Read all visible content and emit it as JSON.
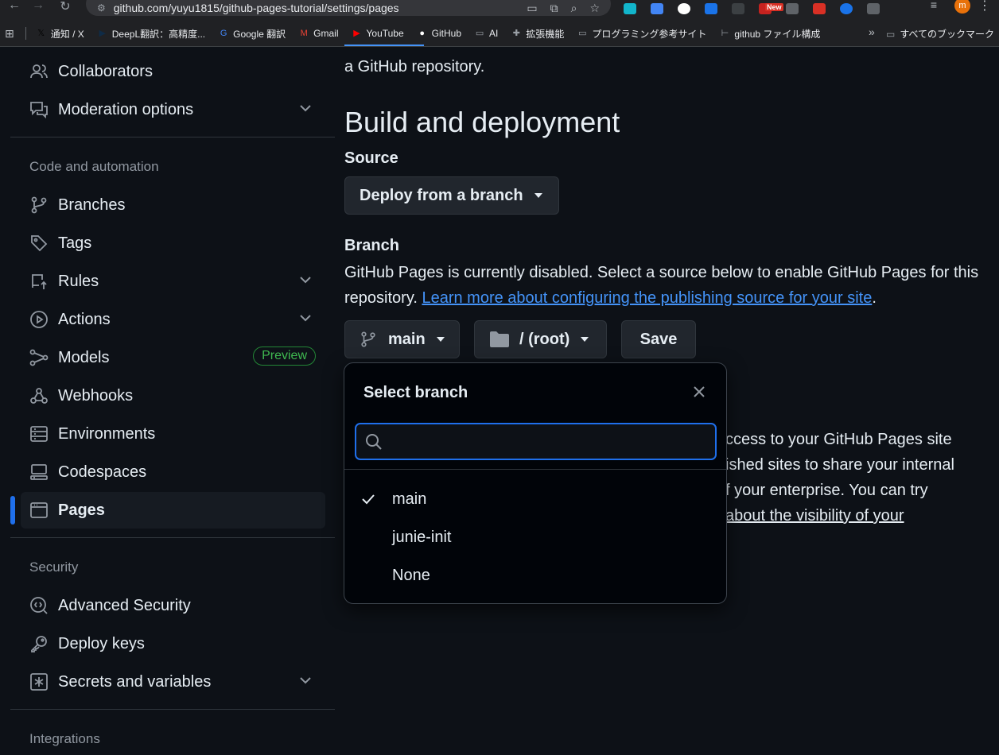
{
  "browser": {
    "url": "github.com/yuyu1815/github-pages-tutorial/settings/pages",
    "ext_new_badge": "New",
    "avatar_letter": "m",
    "bookmarks": [
      {
        "label": "通知 / X",
        "icon": "x-logo-icon",
        "color": "#000000"
      },
      {
        "label": "DeepL翻訳：高精度...",
        "icon": "deepl-icon",
        "color": "#0f2b46"
      },
      {
        "label": "Google 翻訳",
        "icon": "google-translate-icon",
        "color": "#4285f4"
      },
      {
        "label": "Gmail",
        "icon": "gmail-icon",
        "color": "#ea4335"
      },
      {
        "label": "YouTube",
        "icon": "youtube-icon",
        "color": "#ff0000"
      },
      {
        "label": "GitHub",
        "icon": "github-icon",
        "color": "#ffffff"
      },
      {
        "label": "AI",
        "icon": "folder-icon",
        "color": "#9aa0a6"
      },
      {
        "label": "拡張機能",
        "icon": "puzzle-icon",
        "color": "#9aa0a6"
      },
      {
        "label": "プログラミング参考サイト",
        "icon": "folder-icon",
        "color": "#9aa0a6"
      },
      {
        "label": "github ファイル構成",
        "icon": "doc-icon",
        "color": "#9aa0a6"
      }
    ],
    "all_bookmarks": "すべてのブックマーク"
  },
  "sidebar": {
    "top_items": [
      {
        "label": "Collaborators",
        "icon": "people-icon"
      },
      {
        "label": "Moderation options",
        "icon": "comment-discussion-icon",
        "expandable": true
      }
    ],
    "code_heading": "Code and automation",
    "code_items": [
      {
        "label": "Branches",
        "icon": "git-branch-icon"
      },
      {
        "label": "Tags",
        "icon": "tag-icon"
      },
      {
        "label": "Rules",
        "icon": "repo-push-icon",
        "expandable": true
      },
      {
        "label": "Actions",
        "icon": "play-icon",
        "expandable": true
      },
      {
        "label": "Models",
        "icon": "ai-model-icon",
        "badge": "Preview"
      },
      {
        "label": "Webhooks",
        "icon": "webhook-icon"
      },
      {
        "label": "Environments",
        "icon": "server-icon"
      },
      {
        "label": "Codespaces",
        "icon": "codespaces-icon"
      },
      {
        "label": "Pages",
        "icon": "browser-icon",
        "active": true
      }
    ],
    "security_heading": "Security",
    "security_items": [
      {
        "label": "Advanced Security",
        "icon": "codescan-icon"
      },
      {
        "label": "Deploy keys",
        "icon": "key-icon"
      },
      {
        "label": "Secrets and variables",
        "icon": "key-asterisk-icon",
        "expandable": true
      }
    ],
    "integrations_heading": "Integrations"
  },
  "main": {
    "intro_text": "a GitHub repository.",
    "build_heading": "Build and deployment",
    "source_label": "Source",
    "source_button": "Deploy from a branch",
    "branch_label": "Branch",
    "branch_desc": "GitHub Pages is currently disabled. Select a source below to enable GitHub Pages for this repository.",
    "branch_link": "Learn more about configuring the publishing source for your site",
    "branch_link_tail": ".",
    "branch_button": "main",
    "folder_button": "/ (root)",
    "save_button": "Save",
    "behind_lines": [
      "ccess to your GitHub Pages site",
      "ished sites to share your internal",
      "f your enterprise. You can try"
    ],
    "behind_link": "about the visibility of your"
  },
  "dropdown": {
    "title": "Select branch",
    "search_value": "",
    "search_placeholder": "",
    "items": [
      {
        "label": "main",
        "selected": true
      },
      {
        "label": "junie-init",
        "selected": false
      },
      {
        "label": "None",
        "selected": false
      }
    ]
  },
  "colors": {
    "bg": "#0d1117",
    "accent": "#1f6feb",
    "link": "#4493f8",
    "preview_green": "#3fb950"
  }
}
